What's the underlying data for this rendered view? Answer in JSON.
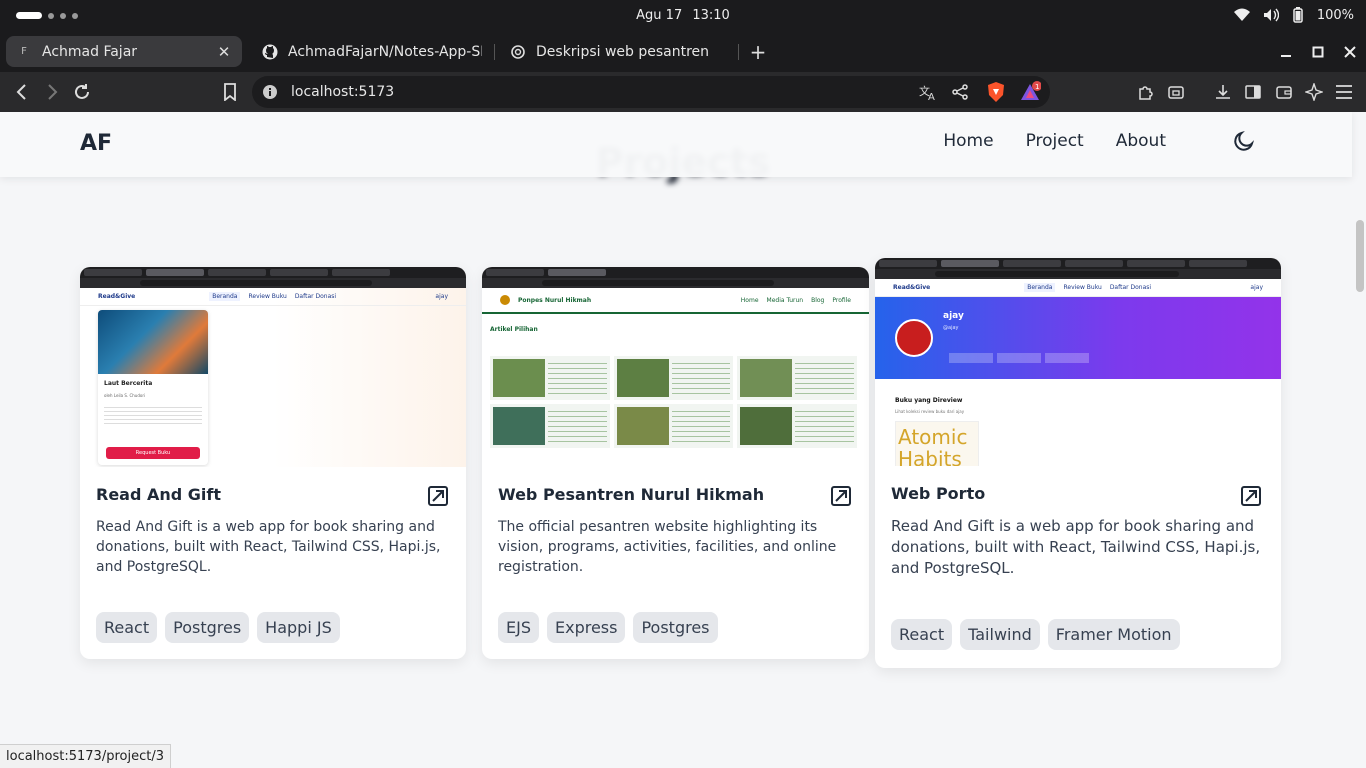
{
  "os": {
    "date": "Agu 17",
    "time": "13:10",
    "battery": "100%"
  },
  "tabs": [
    {
      "title": "Achmad Fajar",
      "favicon": "F"
    },
    {
      "title": "AchmadFajarN/Notes-App-SP",
      "favicon": "github-icon"
    },
    {
      "title": "Deskripsi web pesantren",
      "favicon": "chatgpt-icon"
    }
  ],
  "address": {
    "url": "localhost:5173",
    "shields_badge": "1"
  },
  "page": {
    "logo": "AF",
    "nav": [
      "Home",
      "Project",
      "About"
    ],
    "section_title": "Projects",
    "cards": [
      {
        "title": "Read And Gift",
        "description": "Read And Gift is a web app for book sharing and donations, built with React, Tailwind CSS, Hapi.js, and PostgreSQL.",
        "tags": [
          "React",
          "Postgres",
          "Happi JS"
        ],
        "shot": {
          "brand": "Read&Give",
          "menu": [
            "Beranda",
            "Review Buku",
            "Daftar Donasi"
          ],
          "user": "ajay",
          "book_title": "Laut Bercerita",
          "book_author": "oleh Leila S. Chudori",
          "button": "Request Buku"
        }
      },
      {
        "title": "Web Pesantren Nurul Hikmah",
        "description": "The official pesantren website highlighting its vision, programs, activities, facilities, and online registration.",
        "tags": [
          "EJS",
          "Express",
          "Postgres"
        ],
        "shot": {
          "brand": "Ponpes Nurul Hikmah",
          "menu": [
            "Home",
            "Media Turun",
            "Blog",
            "Profile"
          ],
          "heading": "Artikel Pilihan"
        }
      },
      {
        "title": "Web Porto",
        "description": "Read And Gift is a web app for book sharing and donations, built with React, Tailwind CSS, Hapi.js, and PostgreSQL.",
        "tags": [
          "React",
          "Tailwind",
          "Framer Motion"
        ],
        "shot": {
          "brand": "Read&Give",
          "menu": [
            "Beranda",
            "Review Buku",
            "Daftar Donasi"
          ],
          "user": "ajay",
          "profile_name": "ajay",
          "profile_handle": "@ajay",
          "section": "Buku yang Direview",
          "section_sub": "Lihat koleksi review buku dari ajay",
          "book": "Atomic Habits"
        }
      }
    ]
  },
  "status_url": "localhost:5173/project/3"
}
